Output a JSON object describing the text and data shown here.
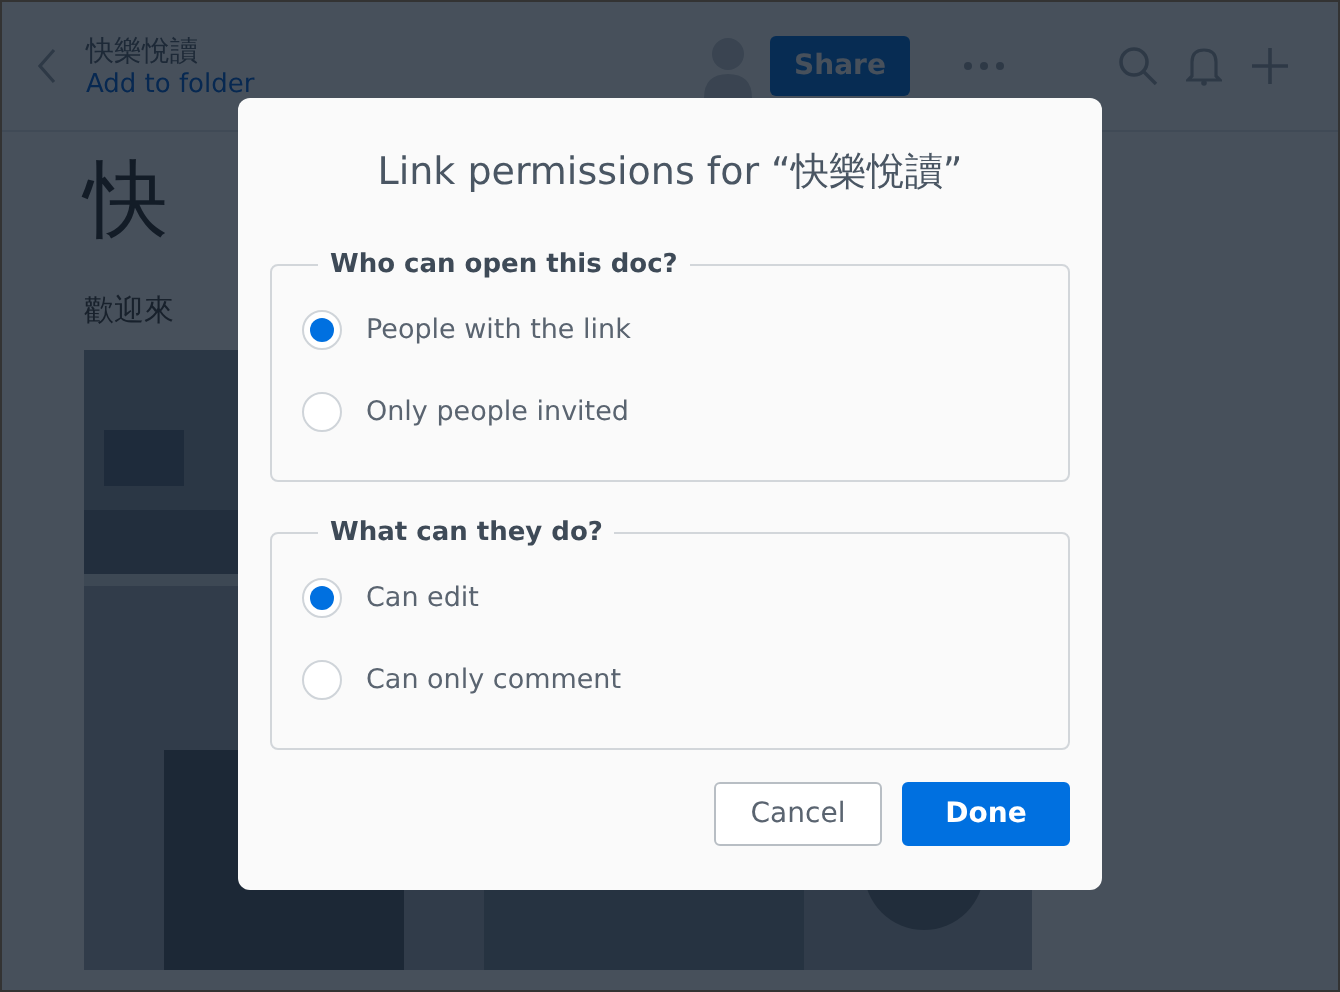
{
  "header": {
    "doc_title": "快樂悅讀",
    "folder_link": "Add to folder",
    "share_button": "Share"
  },
  "document": {
    "heading": "快",
    "intro": "歡迎來"
  },
  "dialog": {
    "title": "Link permissions for “快樂悅讀”",
    "groups": [
      {
        "legend": "Who can open this doc?",
        "options": [
          {
            "label": "People with the link",
            "selected": true
          },
          {
            "label": "Only people invited",
            "selected": false
          }
        ]
      },
      {
        "legend": "What can they do?",
        "options": [
          {
            "label": "Can edit",
            "selected": true
          },
          {
            "label": "Can only comment",
            "selected": false
          }
        ]
      }
    ],
    "buttons": [
      {
        "label": "Cancel",
        "kind": "secondary"
      },
      {
        "label": "Done",
        "kind": "primary"
      }
    ]
  }
}
